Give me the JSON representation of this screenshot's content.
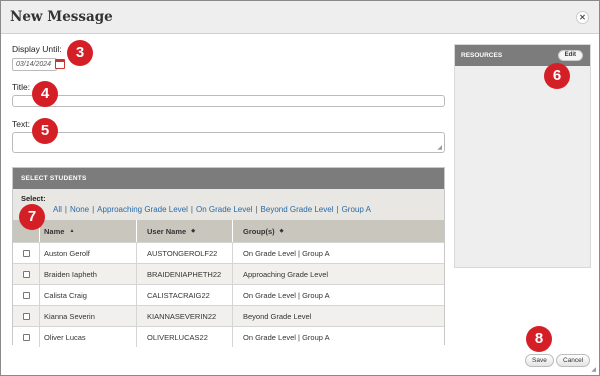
{
  "dialog": {
    "title": "New Message",
    "close_icon": "close-icon"
  },
  "form": {
    "display_until_label": "Display Until:",
    "display_until_value": "03/14/2024",
    "title_label": "Title:",
    "title_value": "",
    "text_label": "Text:",
    "text_value": ""
  },
  "students": {
    "header": "SELECT STUDENTS",
    "select_label": "Select:",
    "filters": [
      "All",
      "None",
      "Approaching Grade Level",
      "On Grade Level",
      "Beyond Grade Level",
      "Group A"
    ],
    "columns": [
      "Name",
      "User Name",
      "Group(s)"
    ],
    "rows": [
      {
        "name": "Auston Gerolf",
        "username": "AUSTONGEROLF22",
        "groups": "On Grade Level | Group A"
      },
      {
        "name": "Braiden Iapheth",
        "username": "BRAIDENIAPHETH22",
        "groups": "Approaching Grade Level"
      },
      {
        "name": "Calista Craig",
        "username": "CALISTACRAIG22",
        "groups": "On Grade Level | Group A"
      },
      {
        "name": "Kianna Severin",
        "username": "KIANNASEVERIN22",
        "groups": "Beyond Grade Level"
      },
      {
        "name": "Oliver Lucas",
        "username": "OLIVERLUCAS22",
        "groups": "On Grade Level | Group A"
      }
    ]
  },
  "resources": {
    "header": "RESOURCES",
    "edit_label": "Edit"
  },
  "footer": {
    "save_label": "Save",
    "cancel_label": "Cancel"
  },
  "callouts": [
    "3",
    "4",
    "5",
    "6",
    "7",
    "8"
  ],
  "colors": {
    "callout": "#d51f27",
    "header_bar": "#7c7c7c",
    "link": "#2a6aa6"
  }
}
